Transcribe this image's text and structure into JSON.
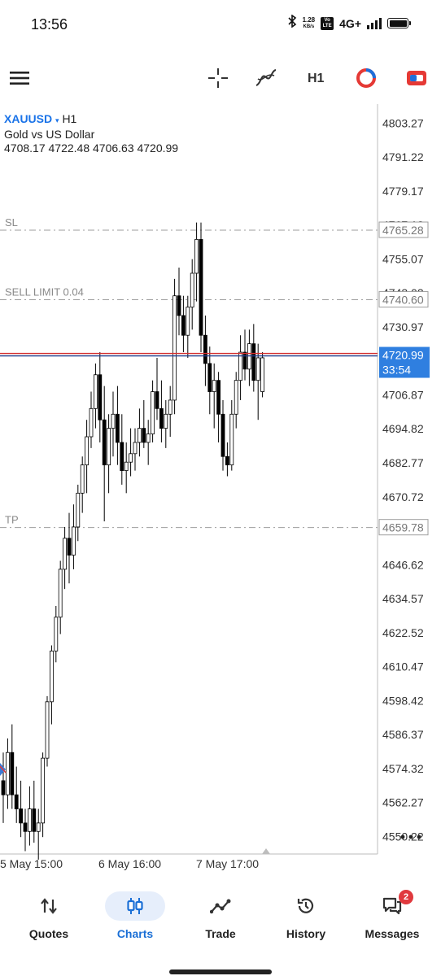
{
  "status_bar": {
    "time": "13:56",
    "speed_value": "1.28",
    "speed_unit": "KB/s",
    "volte": "Vo LTE",
    "network": "4G+"
  },
  "toolbar": {
    "timeframe": "H1",
    "icons": [
      "menu-icon",
      "crosshair-icon",
      "indicators-icon",
      "timeframe-label",
      "trade-toggle-icon",
      "one-click-trading-icon"
    ]
  },
  "chart": {
    "symbol": "XAUUSD",
    "symbol_arrow": "▾",
    "timeframe": "H1",
    "description": "Gold vs US Dollar",
    "ohlc": "4708.17 4722.48 4706.63 4720.99",
    "price_labels": [
      "4803.27",
      "4791.22",
      "4779.17",
      "4767.12",
      "4755.07",
      "4743.02",
      "4730.97",
      "4718.92",
      "4706.87",
      "4694.82",
      "4682.77",
      "4670.72",
      "4658.67",
      "4646.62",
      "4634.57",
      "4622.52",
      "4610.47",
      "4598.42",
      "4586.37",
      "4574.32",
      "4562.27",
      "4550.22"
    ],
    "levels": [
      {
        "label": "SL",
        "price": "4765.28"
      },
      {
        "label": "SELL LIMIT 0.04",
        "price": "4740.60"
      },
      {
        "label": "TP",
        "price": "4659.78"
      }
    ],
    "current_price": "4720.99",
    "countdown": "33:54",
    "time_labels": [
      "5 May 15:00",
      "6 May 16:00",
      "7 May 17:00"
    ],
    "colors": {
      "bid_line": "#1e3a8a",
      "ask_line": "#d32f2f",
      "price_tag": "#2f7fe0",
      "level_line": "#9e9e9e"
    }
  },
  "chart_data": {
    "type": "candlestick",
    "symbol": "XAUUSD",
    "timeframe": "H1",
    "ylim": [
      4544,
      4810
    ],
    "candles": [
      [
        4570,
        4580,
        4555,
        4565
      ],
      [
        4565,
        4585,
        4560,
        4580
      ],
      [
        4580,
        4590,
        4560,
        4565
      ],
      [
        4565,
        4575,
        4555,
        4560
      ],
      [
        4560,
        4570,
        4550,
        4555
      ],
      [
        4555,
        4560,
        4545,
        4552
      ],
      [
        4552,
        4568,
        4547,
        4560
      ],
      [
        4560,
        4570,
        4548,
        4552
      ],
      [
        4552,
        4560,
        4542,
        4555
      ],
      [
        4555,
        4580,
        4550,
        4578
      ],
      [
        4578,
        4600,
        4575,
        4598
      ],
      [
        4598,
        4618,
        4590,
        4616
      ],
      [
        4616,
        4632,
        4612,
        4628
      ],
      [
        4628,
        4648,
        4622,
        4645
      ],
      [
        4645,
        4660,
        4638,
        4656
      ],
      [
        4656,
        4665,
        4640,
        4650
      ],
      [
        4650,
        4668,
        4645,
        4660
      ],
      [
        4660,
        4675,
        4655,
        4672
      ],
      [
        4672,
        4685,
        4665,
        4682
      ],
      [
        4682,
        4698,
        4672,
        4692
      ],
      [
        4692,
        4708,
        4688,
        4702
      ],
      [
        4702,
        4718,
        4695,
        4714
      ],
      [
        4714,
        4722,
        4690,
        4698
      ],
      [
        4698,
        4710,
        4662,
        4682
      ],
      [
        4682,
        4700,
        4672,
        4695
      ],
      [
        4695,
        4708,
        4685,
        4700
      ],
      [
        4700,
        4710,
        4682,
        4690
      ],
      [
        4690,
        4700,
        4675,
        4680
      ],
      [
        4680,
        4690,
        4672,
        4683
      ],
      [
        4683,
        4695,
        4678,
        4686
      ],
      [
        4686,
        4695,
        4680,
        4690
      ],
      [
        4690,
        4702,
        4685,
        4695
      ],
      [
        4695,
        4705,
        4688,
        4690
      ],
      [
        4690,
        4698,
        4682,
        4693
      ],
      [
        4693,
        4712,
        4690,
        4708
      ],
      [
        4708,
        4720,
        4698,
        4702
      ],
      [
        4702,
        4712,
        4690,
        4695
      ],
      [
        4695,
        4705,
        4688,
        4700
      ],
      [
        4700,
        4710,
        4692,
        4705
      ],
      [
        4705,
        4748,
        4700,
        4742
      ],
      [
        4742,
        4752,
        4728,
        4735
      ],
      [
        4735,
        4742,
        4722,
        4728
      ],
      [
        4728,
        4742,
        4720,
        4738
      ],
      [
        4738,
        4755,
        4730,
        4750
      ],
      [
        4750,
        4768,
        4740,
        4762
      ],
      [
        4762,
        4768,
        4722,
        4728
      ],
      [
        4728,
        4735,
        4710,
        4718
      ],
      [
        4718,
        4724,
        4700,
        4708
      ],
      [
        4708,
        4718,
        4695,
        4712
      ],
      [
        4712,
        4715,
        4690,
        4700
      ],
      [
        4700,
        4705,
        4680,
        4685
      ],
      [
        4685,
        4690,
        4678,
        4682
      ],
      [
        4682,
        4705,
        4680,
        4700
      ],
      [
        4700,
        4715,
        4695,
        4712
      ],
      [
        4712,
        4728,
        4705,
        4722
      ],
      [
        4722,
        4730,
        4712,
        4716
      ],
      [
        4716,
        4730,
        4710,
        4725
      ],
      [
        4725,
        4732,
        4708,
        4712
      ],
      [
        4712,
        4725,
        4698,
        4720
      ],
      [
        4708,
        4722,
        4706,
        4720
      ]
    ]
  }
}
